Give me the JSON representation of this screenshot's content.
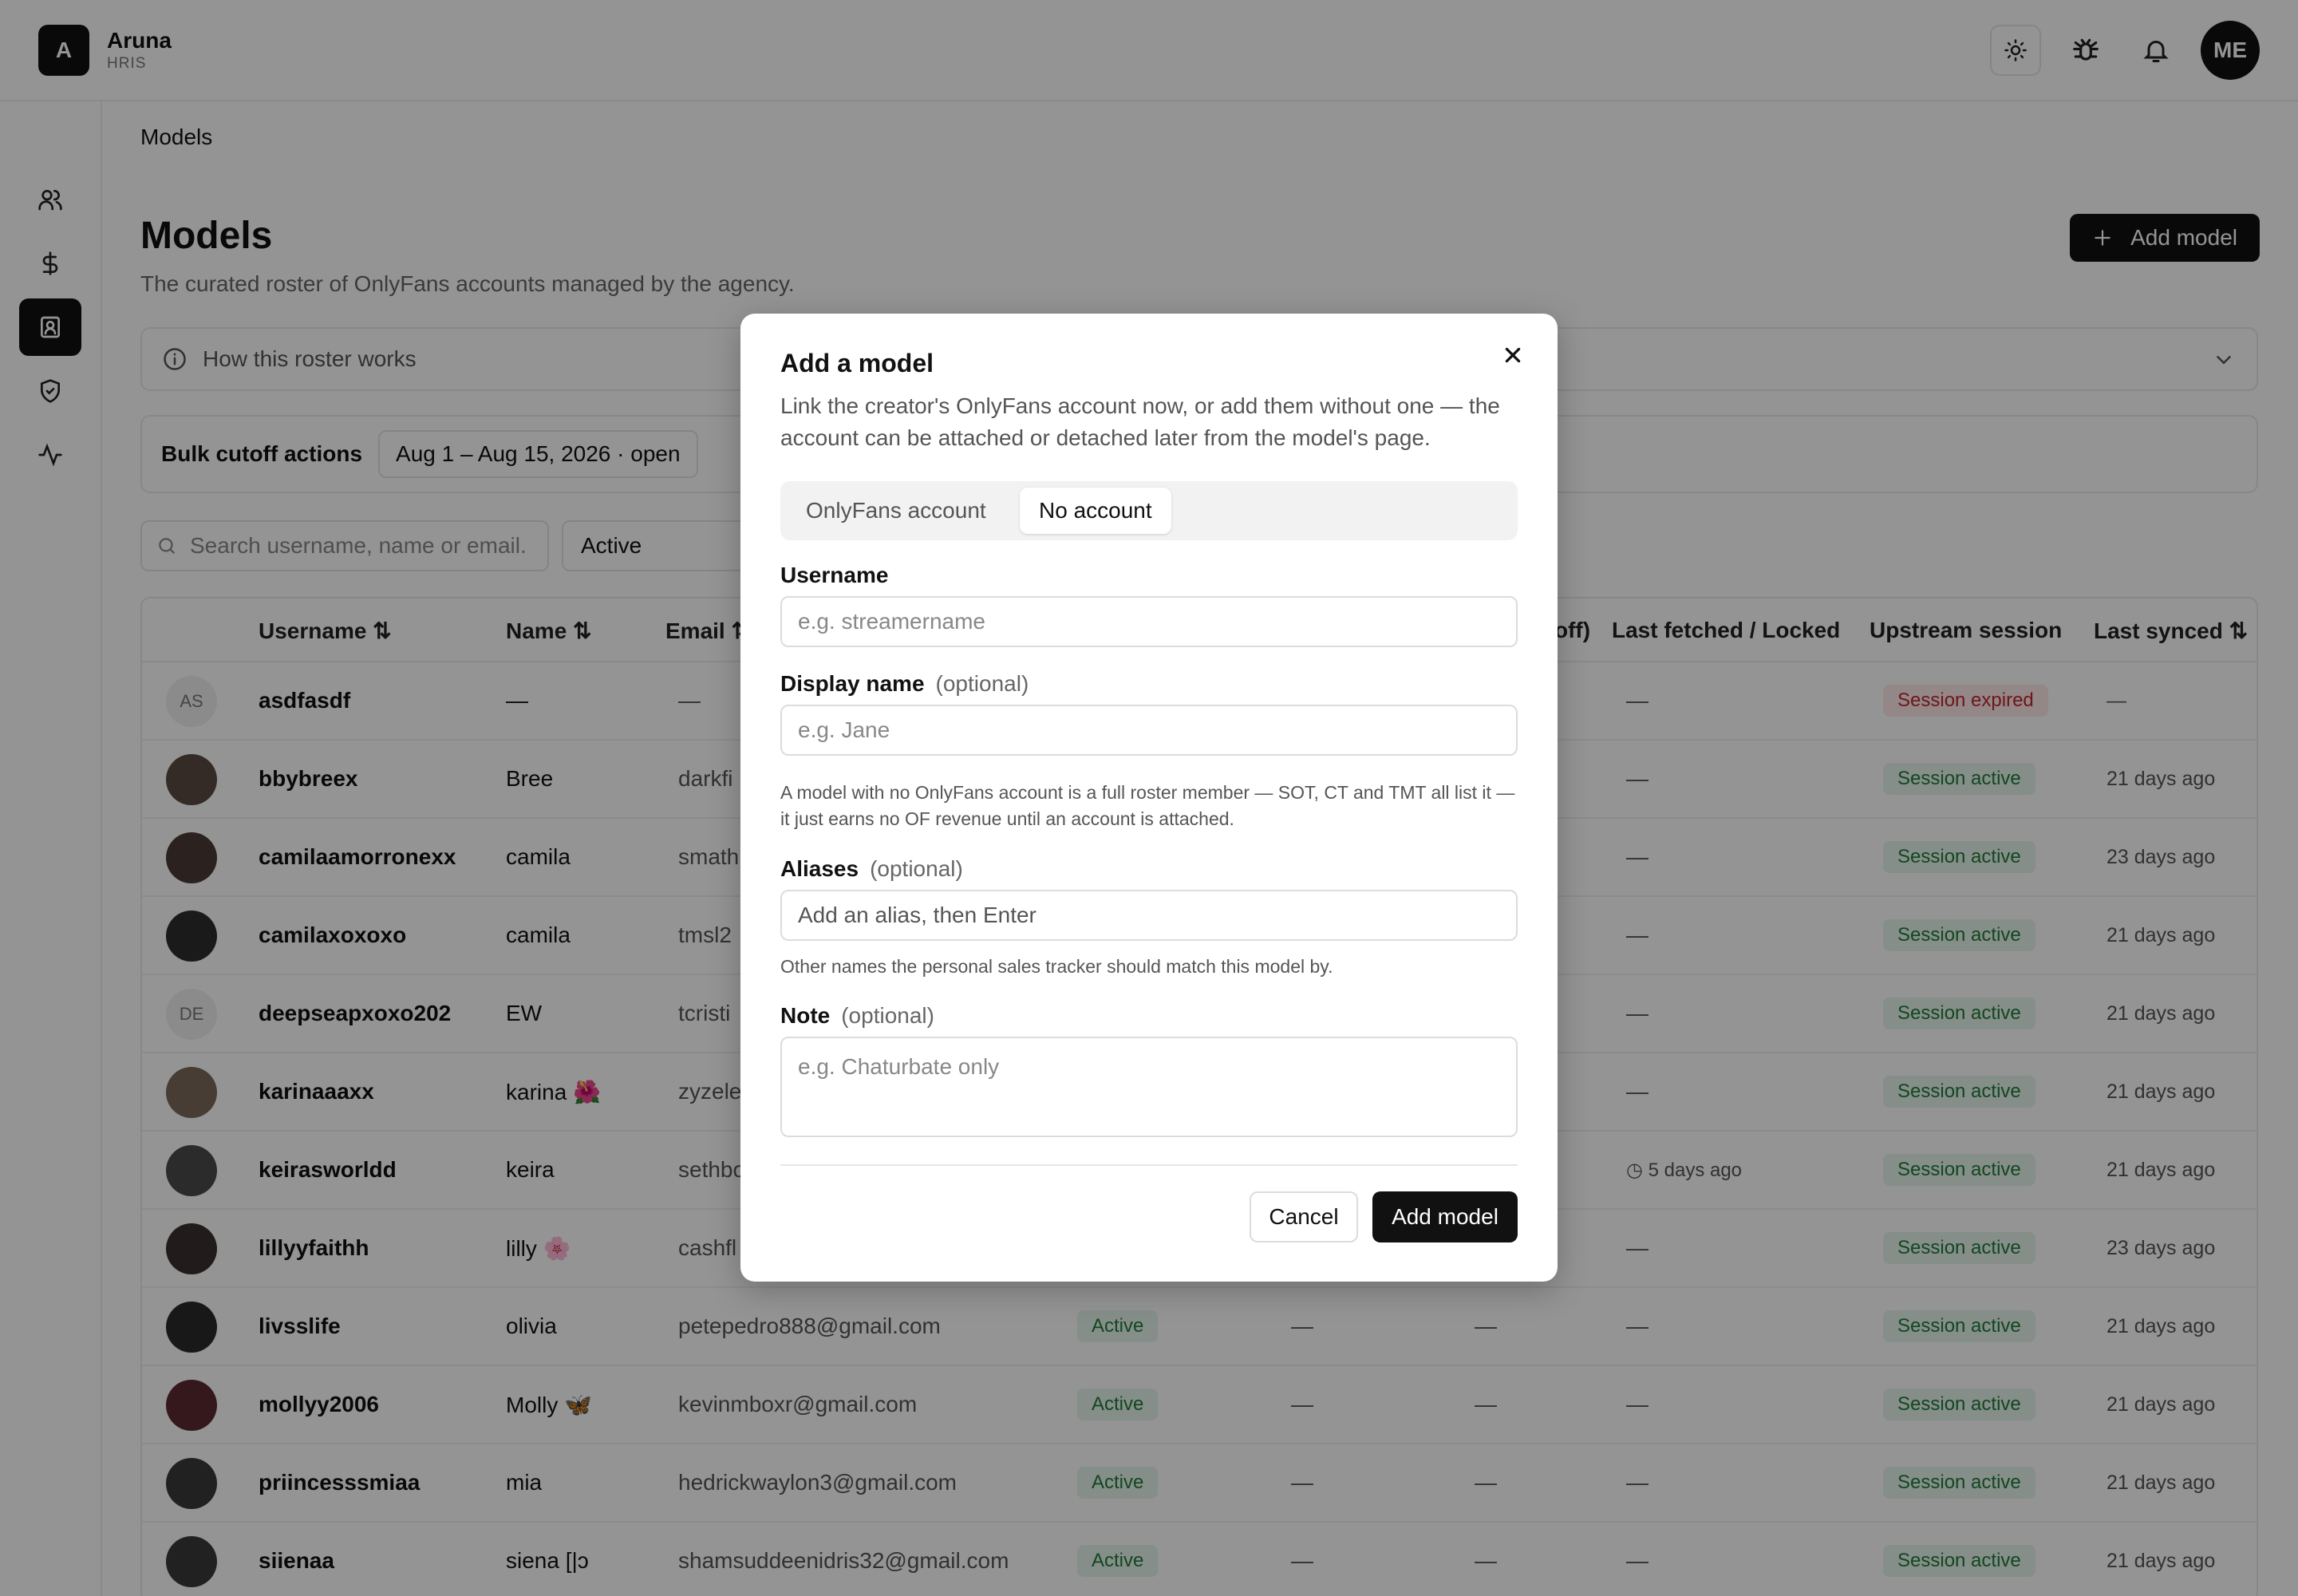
{
  "app": {
    "logo_letter": "A",
    "name": "Aruna",
    "subtitle": "HRIS",
    "user_initials": "ME"
  },
  "breadcrumb": "Models",
  "page": {
    "title": "Models",
    "subtitle": "The curated roster of OnlyFans accounts managed by the agency.",
    "add_button": "Add model",
    "howto": "How this roster works",
    "bulk_label": "Bulk cutoff actions",
    "bulk_range": "Aug 1 – Aug 15, 2026 · open",
    "search_placeholder": "Search username, name or email.",
    "status_filter": "Active"
  },
  "table": {
    "headers": {
      "username": "Username",
      "name": "Name",
      "email": "Email",
      "cutoff": "off)",
      "last_fetched": "Last fetched / Locked",
      "upstream": "Upstream session",
      "last_synced": "Last synced"
    },
    "rows": [
      {
        "initials": "AS",
        "username": "asdfasdf",
        "name": "—",
        "email": "—",
        "status": "",
        "c1": "",
        "c2": "",
        "fetched": "—",
        "session": "Session expired",
        "synced": "—"
      },
      {
        "initials": "",
        "username": "bbybreex",
        "name": "Bree",
        "email": "darkfi",
        "status": "",
        "c1": "",
        "c2": "",
        "fetched": "—",
        "session": "Session active",
        "synced": "21 days ago"
      },
      {
        "initials": "",
        "username": "camilaamorronexx",
        "name": "camila",
        "email": "smath",
        "status": "",
        "c1": "",
        "c2": "",
        "fetched": "—",
        "session": "Session active",
        "synced": "23 days ago"
      },
      {
        "initials": "",
        "username": "camilaxoxoxo",
        "name": "camila",
        "email": "tmsl2",
        "status": "",
        "c1": "",
        "c2": "",
        "fetched": "—",
        "session": "Session active",
        "synced": "21 days ago"
      },
      {
        "initials": "DE",
        "username": "deepseapxoxo202",
        "name": "EW",
        "email": "tcristi",
        "status": "",
        "c1": "",
        "c2": "",
        "fetched": "—",
        "session": "Session active",
        "synced": "21 days ago"
      },
      {
        "initials": "",
        "username": "karinaaaxx",
        "name": "karina 🌺",
        "email": "zyzele",
        "status": "",
        "c1": "",
        "c2": "",
        "fetched": "—",
        "session": "Session active",
        "synced": "21 days ago"
      },
      {
        "initials": "",
        "username": "keirasworldd",
        "name": "keira",
        "email": "sethbo",
        "status": "",
        "c1": "",
        "c2": "",
        "fetched": "5 days ago",
        "session": "Session active",
        "synced": "21 days ago"
      },
      {
        "initials": "",
        "username": "lillyyfaithh",
        "name": "lilly 🌸",
        "email": "cashfl",
        "status": "",
        "c1": "",
        "c2": "",
        "fetched": "—",
        "session": "Session active",
        "synced": "23 days ago"
      },
      {
        "initials": "",
        "username": "livsslife",
        "name": "olivia",
        "email": "petepedro888@gmail.com",
        "status": "Active",
        "c1": "—",
        "c2": "—",
        "fetched": "—",
        "session": "Session active",
        "synced": "21 days ago"
      },
      {
        "initials": "",
        "username": "mollyy2006",
        "name": "Molly 🦋",
        "email": "kevinmboxr@gmail.com",
        "status": "Active",
        "c1": "—",
        "c2": "—",
        "fetched": "—",
        "session": "Session active",
        "synced": "21 days ago"
      },
      {
        "initials": "",
        "username": "priincesssmiaa",
        "name": "mia",
        "email": "hedrickwaylon3@gmail.com",
        "status": "Active",
        "c1": "—",
        "c2": "—",
        "fetched": "—",
        "session": "Session active",
        "synced": "21 days ago"
      },
      {
        "initials": "",
        "username": "siienaa",
        "name": "siena [|ɔ",
        "email": "shamsuddeenidris32@gmail.com",
        "status": "Active",
        "c1": "—",
        "c2": "—",
        "fetched": "—",
        "session": "Session active",
        "synced": "21 days ago"
      }
    ]
  },
  "modal": {
    "title": "Add a model",
    "description": "Link the creator's OnlyFans account now, or add them without one — the account can be attached or detached later from the model's page.",
    "tabs": [
      "OnlyFans account",
      "No account"
    ],
    "selected_tab": "No account",
    "username_label": "Username",
    "username_placeholder": "e.g. streamername",
    "display_label": "Display name",
    "optional": "(optional)",
    "display_placeholder": "e.g. Jane",
    "no_account_note": "A model with no OnlyFans account is a full roster member — SOT, CT and TMT all list it — it just earns no OF revenue until an account is attached.",
    "aliases_label": "Aliases",
    "aliases_placeholder": "Add an alias, then Enter",
    "aliases_help": "Other names the personal sales tracker should match this model by.",
    "note_label": "Note",
    "note_placeholder": "e.g. Chaturbate only",
    "cancel": "Cancel",
    "submit": "Add model"
  },
  "colors": {
    "accent": "#111111",
    "success_bg": "#e6f4ea",
    "success_text": "#1f7a3a",
    "danger_bg": "#fde8e8",
    "danger_text": "#c0262d"
  }
}
